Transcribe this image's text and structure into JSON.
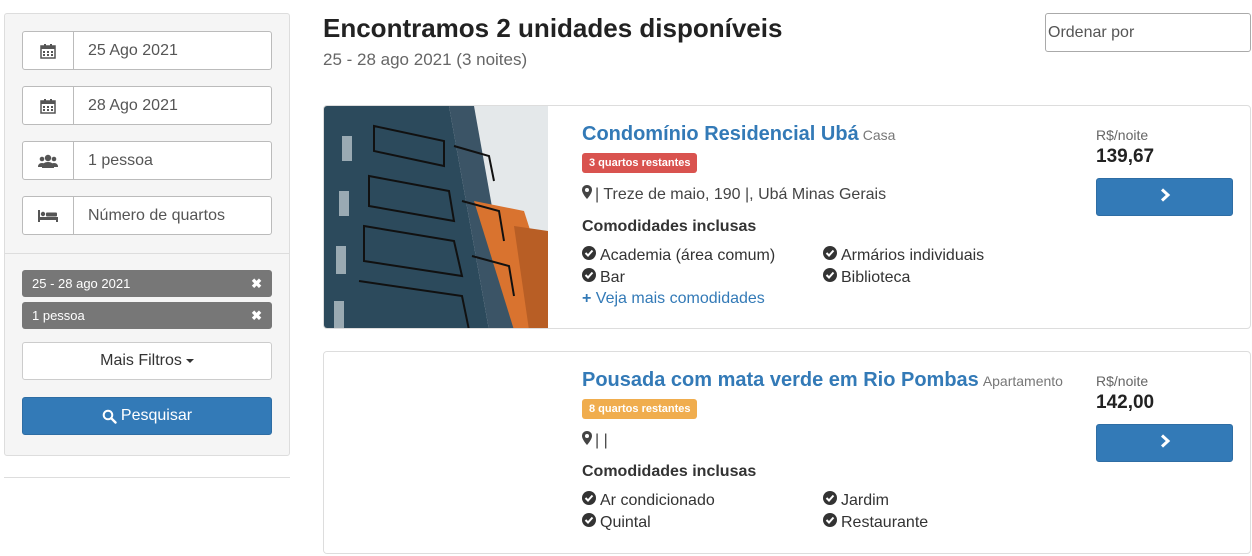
{
  "sidebar": {
    "checkin": "25 Ago 2021",
    "checkout": "28 Ago 2021",
    "guests": "1 pessoa",
    "rooms_placeholder": "Número de quartos",
    "tags": [
      {
        "label": "25 - 28 ago 2021"
      },
      {
        "label": "1 pessoa"
      }
    ],
    "more_filters": "Mais Filtros",
    "search": "Pesquisar"
  },
  "header": {
    "title": "Encontramos 2 unidades disponíveis",
    "subtitle": "25 - 28 ago 2021 (3 noites)",
    "sort_placeholder": "Ordenar por"
  },
  "results": [
    {
      "name": "Condomínio Residencial Ubá",
      "type": "Casa",
      "rooms_left": "3 quartos restantes",
      "rooms_color": "#d9534f",
      "address": "| Treze de maio, 190 |, Ubá Minas Gerais",
      "amenities_title": "Comodidades inclusas",
      "amenities": [
        "Academia (área comum)",
        "Armários individuais",
        "Bar",
        "Biblioteca"
      ],
      "more_amenities": "Veja mais comodidades",
      "price_label": "R$/noite",
      "price": "139,67"
    },
    {
      "name": "Pousada com mata verde em Rio Pombas",
      "type": "Apartamento",
      "rooms_left": "8 quartos restantes",
      "rooms_color": "#f0ad4e",
      "address": "| |",
      "amenities_title": "Comodidades inclusas",
      "amenities": [
        "Ar condicionado",
        "Jardim",
        "Quintal",
        "Restaurante"
      ],
      "price_label": "R$/noite",
      "price": "142,00"
    }
  ],
  "colors": {
    "primary": "#337ab7",
    "tag": "#777777"
  },
  "icons": [
    "calendar-icon",
    "users-icon",
    "bed-icon",
    "close-icon",
    "caret-down-icon",
    "search-icon",
    "map-marker-icon",
    "check-circle-icon",
    "plus-icon",
    "chevron-right-icon"
  ]
}
